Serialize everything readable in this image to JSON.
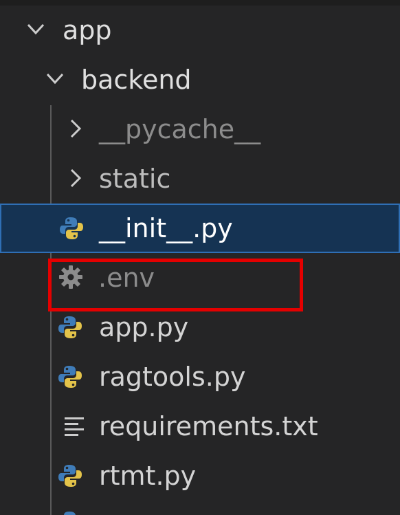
{
  "explorer": {
    "root": {
      "label": "app",
      "expanded": true,
      "icon": "chevron-down-icon"
    },
    "backend": {
      "label": "backend",
      "expanded": true,
      "icon": "chevron-down-icon"
    },
    "children": [
      {
        "label": "__pycache__",
        "type": "folder",
        "icon": "chevron-right-icon",
        "color": "#8c8c8c"
      },
      {
        "label": "static",
        "type": "folder",
        "icon": "chevron-right-icon",
        "color": "#bdbdbd"
      },
      {
        "label": "__init__.py",
        "type": "python-file",
        "icon": "python-icon",
        "color": "#ffffff",
        "selected": true
      },
      {
        "label": ".env",
        "type": "env-file",
        "icon": "gear-icon",
        "color": "#8c8c8c",
        "highlighted": true
      },
      {
        "label": "app.py",
        "type": "python-file",
        "icon": "python-icon",
        "color": "#d4d4d4"
      },
      {
        "label": "ragtools.py",
        "type": "python-file",
        "icon": "python-icon",
        "color": "#d4d4d4"
      },
      {
        "label": "requirements.txt",
        "type": "text-file",
        "icon": "text-file-icon",
        "color": "#d4d4d4"
      },
      {
        "label": "rtmt.py",
        "type": "python-file",
        "icon": "python-icon",
        "color": "#d4d4d4"
      }
    ]
  },
  "colors": {
    "background": "#252526",
    "selection": "#153353",
    "selection_border": "#2f6fb5",
    "highlight_box": "#e40000",
    "python_blue": "#3f7cb8",
    "python_yellow": "#e3c34a"
  }
}
